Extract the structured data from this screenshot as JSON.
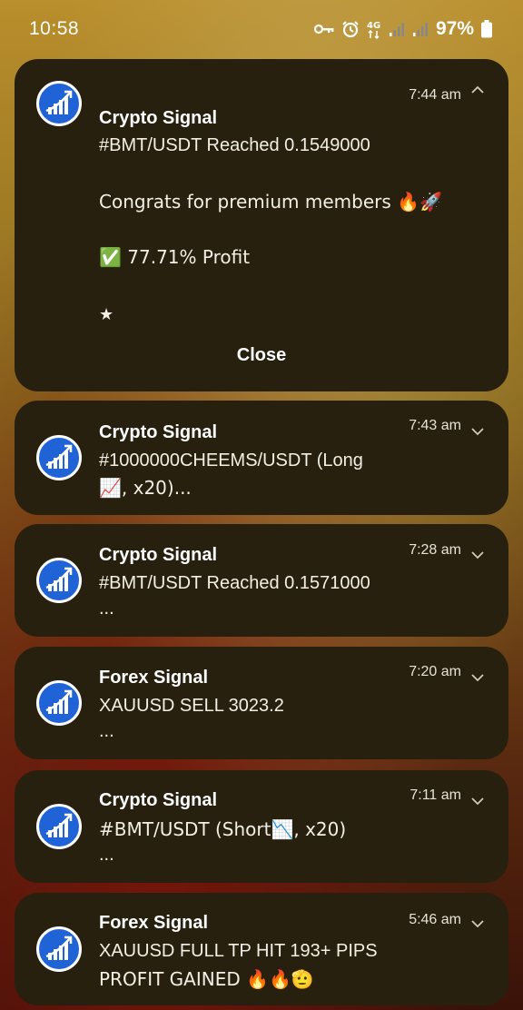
{
  "status_bar": {
    "time": "10:58",
    "icons": [
      "key-icon",
      "alarm-icon",
      "4g-icon",
      "signal-icon",
      "signal-icon",
      "battery-icon"
    ],
    "network": "4G",
    "battery": "97%"
  },
  "notifications": [
    {
      "app": "Crypto Signal",
      "time": "7:44 am",
      "expanded": true,
      "lines": [
        "#BMT/USDT Reached 0.1549000",
        "Congrats for premium members 🔥🚀",
        "✅ 77.71% Profit",
        "★"
      ],
      "action": "Close"
    },
    {
      "app": "Crypto Signal",
      "time": "7:43 am",
      "expanded": false,
      "lines": [
        "#1000000CHEEMS/USDT (Long",
        "📈, x20)..."
      ]
    },
    {
      "app": "Crypto Signal",
      "time": "7:28 am",
      "expanded": false,
      "lines": [
        "#BMT/USDT Reached 0.1571000",
        "..."
      ]
    },
    {
      "app": "Forex Signal",
      "time": "7:20 am",
      "expanded": false,
      "lines": [
        "XAUUSD SELL 3023.2",
        "..."
      ]
    },
    {
      "app": "Crypto Signal",
      "time": "7:11 am",
      "expanded": false,
      "lines": [
        "#BMT/USDT (Short📉, x20)",
        "..."
      ]
    },
    {
      "app": "Forex Signal",
      "time": "5:46 am",
      "expanded": false,
      "lines": [
        "XAUUSD FULL TP HIT 193+ PIPS",
        "PROFIT GAINED 🔥🔥🫡"
      ]
    }
  ],
  "colors": {
    "card_bg": "#27200f",
    "avatar_blue": "#1f63d6"
  }
}
